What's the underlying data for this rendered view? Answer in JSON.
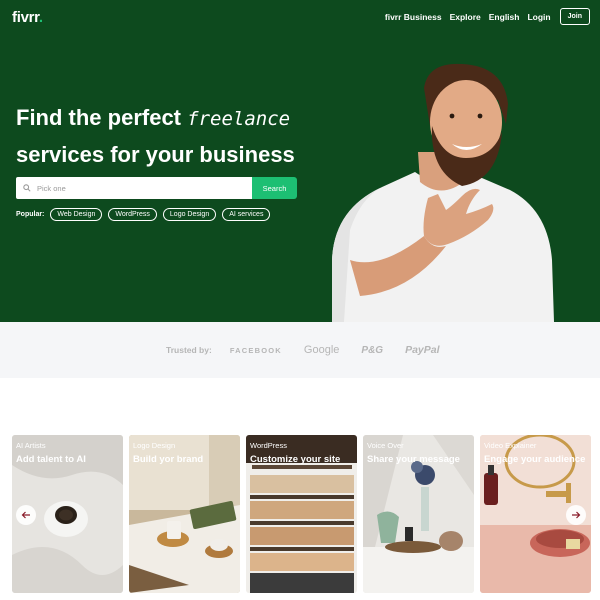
{
  "nav": {
    "logo": "fivrr",
    "logo_dot": ".",
    "links": [
      "fivrr Business",
      "Explore",
      "English",
      "Login"
    ],
    "join_label": "Join"
  },
  "hero": {
    "headline_1": "Find the perfect ",
    "headline_accent": "freelance",
    "headline_2": "services for your business",
    "search": {
      "placeholder": "Pick one",
      "button_label": "Search"
    },
    "popular_label": "Popular:",
    "popular_tags": [
      "Web Design",
      "WordPress",
      "Logo Design",
      "AI services"
    ]
  },
  "trusted": {
    "label": "Trusted by:",
    "brands": [
      "FACEBOOK",
      "Google",
      "P&G",
      "PayPal"
    ]
  },
  "cards": [
    {
      "category": "AI Artists",
      "title": "Add talent to AI"
    },
    {
      "category": "Logo Design",
      "title": "Build yor brand"
    },
    {
      "category": "WordPress",
      "title": "Customize your site"
    },
    {
      "category": "Voice Over",
      "title": "Share your message"
    },
    {
      "category": "Video Explainer",
      "title": "Engage your audience"
    }
  ],
  "carousel": {
    "prev_icon": "arrow-left-icon",
    "next_icon": "arrow-right-icon"
  },
  "colors": {
    "hero_bg": "#0d4a1e",
    "accent_green": "#1dbf73",
    "trusted_bg": "#f5f6f8",
    "arrow_color": "#8a1c2a"
  }
}
